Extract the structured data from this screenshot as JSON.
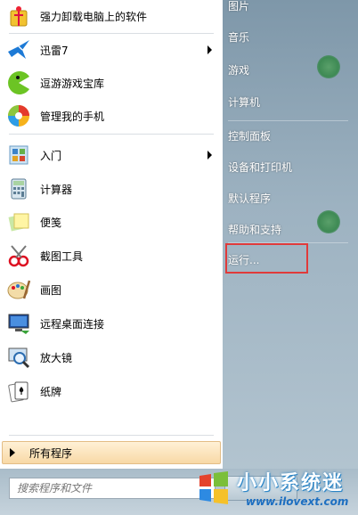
{
  "left_programs": [
    {
      "label": "强力卸载电脑上的软件",
      "icon": "uninstall-icon",
      "arrow": false
    },
    {
      "label": "迅雷7",
      "icon": "thunder-bird-icon",
      "arrow": true
    },
    {
      "label": "逗游游戏宝库",
      "icon": "pacman-game-icon",
      "arrow": false
    },
    {
      "label": "管理我的手机",
      "icon": "phone-manager-icon",
      "arrow": false
    },
    {
      "label": "入门",
      "icon": "getting-started-icon",
      "arrow": true
    },
    {
      "label": "计算器",
      "icon": "calculator-icon",
      "arrow": false
    },
    {
      "label": "便笺",
      "icon": "sticky-notes-icon",
      "arrow": false
    },
    {
      "label": "截图工具",
      "icon": "snipping-tool-icon",
      "arrow": false
    },
    {
      "label": "画图",
      "icon": "paint-icon",
      "arrow": false
    },
    {
      "label": "远程桌面连接",
      "icon": "remote-desktop-icon",
      "arrow": false
    },
    {
      "label": "放大镜",
      "icon": "magnifier-icon",
      "arrow": false
    },
    {
      "label": "纸牌",
      "icon": "solitaire-icon",
      "arrow": false
    }
  ],
  "all_programs": "所有程序",
  "search": {
    "placeholder": "搜索程序和文件"
  },
  "right_items": [
    {
      "label": "图片"
    },
    {
      "label": "音乐"
    },
    {
      "label": "游戏"
    },
    {
      "label": "计算机"
    },
    {
      "label": "控制面板"
    },
    {
      "label": "设备和打印机"
    },
    {
      "label": "默认程序"
    },
    {
      "label": "帮助和支持"
    },
    {
      "label": "运行..."
    }
  ],
  "highlight": {
    "target": "运行...",
    "color": "#e03a3a"
  },
  "watermark": {
    "name": "小小系统迷",
    "url": "www.ilovext.com"
  }
}
